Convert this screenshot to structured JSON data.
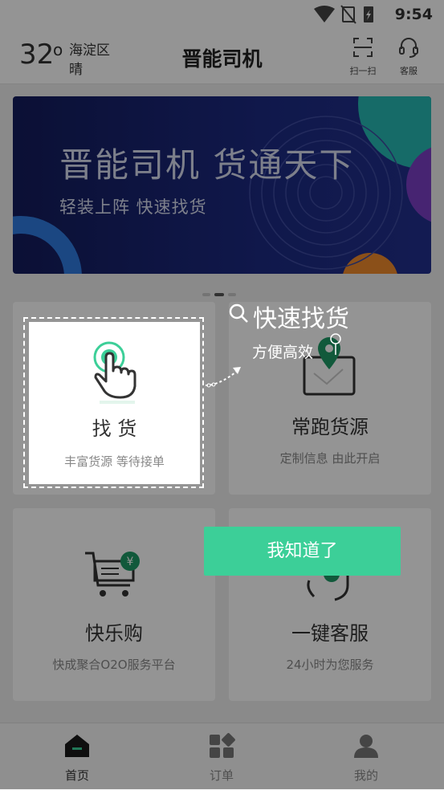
{
  "status_bar": {
    "time": "9:54"
  },
  "header": {
    "temperature": "32",
    "degree_symbol": "o",
    "district": "海淀区",
    "weather": "晴",
    "title": "晋能司机",
    "scan_label": "扫一扫",
    "service_label": "客服"
  },
  "banner": {
    "title": "晋能司机 货通天下",
    "subtitle": "轻装上阵  快速找货",
    "page_count": 3,
    "active_page": 1
  },
  "cards": [
    {
      "title": "找 货",
      "desc": "丰富货源  等待接单",
      "icon": "hand-tap-icon"
    },
    {
      "title": "常跑货源",
      "desc": "定制信息  由此开启",
      "icon": "map-pin-icon"
    },
    {
      "title": "快乐购",
      "desc": "快成聚合O2O服务平台",
      "icon": "shopping-cart-icon"
    },
    {
      "title": "一键客服",
      "desc": "24小时为您服务",
      "icon": "customer-service-icon"
    }
  ],
  "guide": {
    "title": "快速找货",
    "subtitle": "方便高效",
    "confirm_label": "我知道了"
  },
  "bottom_nav": [
    {
      "label": "首页",
      "icon": "home-icon",
      "active": true
    },
    {
      "label": "订单",
      "icon": "orders-icon",
      "active": false
    },
    {
      "label": "我的",
      "icon": "profile-icon",
      "active": false
    }
  ],
  "colors": {
    "accent": "#3ccf98",
    "banner_bg": "#1c2a82",
    "nav_active": "#333333"
  }
}
